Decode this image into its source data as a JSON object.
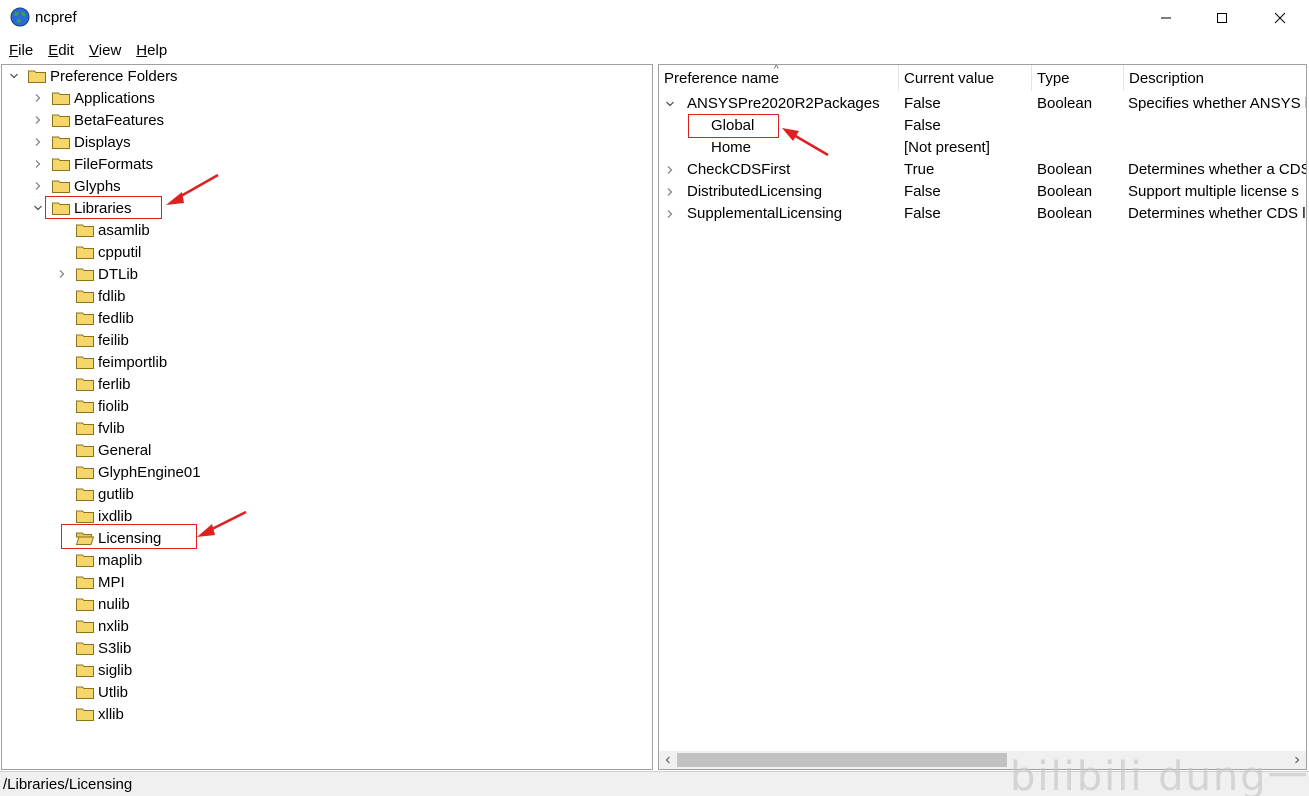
{
  "window": {
    "title": "ncpref",
    "icon": "globe-icon",
    "controls": [
      "minimize-icon",
      "maximize-icon",
      "close-icon"
    ]
  },
  "menu": [
    {
      "label": "File",
      "accel": "F",
      "rest": "ile"
    },
    {
      "label": "Edit",
      "accel": "E",
      "rest": "dit"
    },
    {
      "label": "View",
      "accel": "V",
      "rest": "iew"
    },
    {
      "label": "Help",
      "accel": "H",
      "rest": "elp"
    }
  ],
  "tree": {
    "root": "Preference Folders",
    "items": [
      {
        "label": "Applications",
        "level": 1,
        "expander": "collapsed"
      },
      {
        "label": "BetaFeatures",
        "level": 1,
        "expander": "collapsed"
      },
      {
        "label": "Displays",
        "level": 1,
        "expander": "collapsed"
      },
      {
        "label": "FileFormats",
        "level": 1,
        "expander": "collapsed"
      },
      {
        "label": "Glyphs",
        "level": 1,
        "expander": "collapsed"
      },
      {
        "label": "Libraries",
        "level": 1,
        "expander": "expanded"
      },
      {
        "label": "asamlib",
        "level": 2,
        "expander": "none"
      },
      {
        "label": "cpputil",
        "level": 2,
        "expander": "none"
      },
      {
        "label": "DTLib",
        "level": 2,
        "expander": "collapsed"
      },
      {
        "label": "fdlib",
        "level": 2,
        "expander": "none"
      },
      {
        "label": "fedlib",
        "level": 2,
        "expander": "none"
      },
      {
        "label": "feilib",
        "level": 2,
        "expander": "none"
      },
      {
        "label": "feimportlib",
        "level": 2,
        "expander": "none"
      },
      {
        "label": "ferlib",
        "level": 2,
        "expander": "none"
      },
      {
        "label": "fiolib",
        "level": 2,
        "expander": "none"
      },
      {
        "label": "fvlib",
        "level": 2,
        "expander": "none"
      },
      {
        "label": "General",
        "level": 2,
        "expander": "none"
      },
      {
        "label": "GlyphEngine01",
        "level": 2,
        "expander": "none"
      },
      {
        "label": "gutlib",
        "level": 2,
        "expander": "none"
      },
      {
        "label": "ixdlib",
        "level": 2,
        "expander": "none"
      },
      {
        "label": "Licensing",
        "level": 2,
        "expander": "none",
        "open": true
      },
      {
        "label": "maplib",
        "level": 2,
        "expander": "none"
      },
      {
        "label": "MPI",
        "level": 2,
        "expander": "none"
      },
      {
        "label": "nulib",
        "level": 2,
        "expander": "none"
      },
      {
        "label": "nxlib",
        "level": 2,
        "expander": "none"
      },
      {
        "label": "S3lib",
        "level": 2,
        "expander": "none"
      },
      {
        "label": "siglib",
        "level": 2,
        "expander": "none"
      },
      {
        "label": "Utlib",
        "level": 2,
        "expander": "none"
      },
      {
        "label": "xllib",
        "level": 2,
        "expander": "none"
      }
    ]
  },
  "list": {
    "columns": [
      "Preference name",
      "Current value",
      "Type",
      "Description"
    ],
    "rows": [
      {
        "name": "ANSYSPre2020R2Packages",
        "value": "False",
        "type": "Boolean",
        "description": "Specifies whether ANSYS li",
        "expander": "expanded",
        "indent": 0
      },
      {
        "name": "Global",
        "value": "False",
        "type": "",
        "description": "",
        "expander": "none",
        "indent": 1
      },
      {
        "name": "Home",
        "value": "[Not present]",
        "type": "",
        "description": "",
        "expander": "none",
        "indent": 1
      },
      {
        "name": "CheckCDSFirst",
        "value": "True",
        "type": "Boolean",
        "description": "Determines whether a CDS",
        "expander": "collapsed",
        "indent": 0
      },
      {
        "name": "DistributedLicensing",
        "value": "False",
        "type": "Boolean",
        "description": "Support multiple license s",
        "expander": "collapsed",
        "indent": 0
      },
      {
        "name": "SupplementalLicensing",
        "value": "False",
        "type": "Boolean",
        "description": "Determines whether CDS l",
        "expander": "collapsed",
        "indent": 0
      }
    ]
  },
  "status": {
    "path": "/Libraries/Licensing"
  },
  "watermark": "bilibili dung一T",
  "colors": {
    "highlight": "#e02020",
    "folder": "#f5d66b",
    "chrome": "#f0f0f0"
  }
}
